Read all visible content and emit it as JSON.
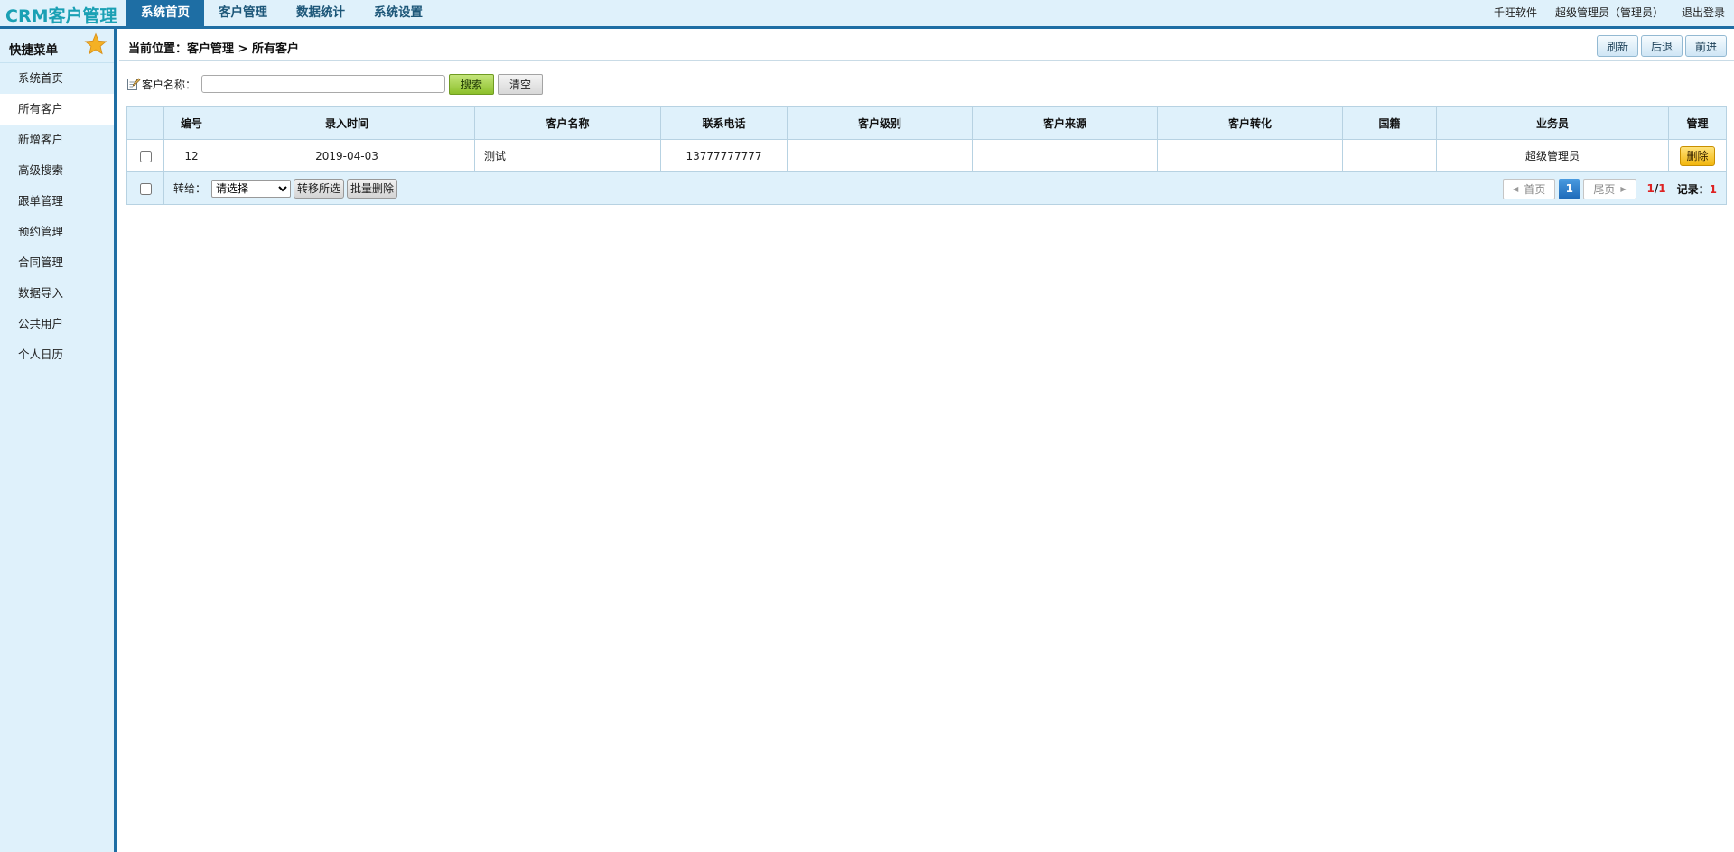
{
  "header": {
    "logo": "CRM客户管理",
    "nav": [
      "系统首页",
      "客户管理",
      "数据统计",
      "系统设置"
    ],
    "right_links": [
      "千旺软件",
      "超级管理员（管理员）",
      "退出登录"
    ]
  },
  "sidebar": {
    "title": "快捷菜单",
    "items": [
      "系统首页",
      "所有客户",
      "新增客户",
      "高级搜索",
      "跟单管理",
      "预约管理",
      "合同管理",
      "数据导入",
      "公共用户",
      "个人日历"
    ],
    "active_index": 1
  },
  "breadcrumb": {
    "text": "当前位置：客户管理 > 所有客户",
    "buttons": [
      "刷新",
      "后退",
      "前进"
    ]
  },
  "search": {
    "label": "客户名称：",
    "value": "",
    "search_btn": "搜索",
    "clear_btn": "清空"
  },
  "table": {
    "headers": [
      "编号",
      "录入时间",
      "客户名称",
      "联系电话",
      "客户级别",
      "客户来源",
      "客户转化",
      "国籍",
      "业务员",
      "管理"
    ],
    "rows": [
      {
        "id": "12",
        "date": "2019-04-03",
        "name": "测试",
        "phone": "13777777777",
        "level": "",
        "source": "",
        "conversion": "",
        "nationality": "",
        "salesman": "超级管理员",
        "action": "删除"
      }
    ]
  },
  "footer": {
    "transfer_label": "转给：",
    "select_value": "请选择",
    "transfer_btn": "转移所选",
    "batch_delete_btn": "批量删除",
    "pager": {
      "first": "首页",
      "current": "1",
      "last": "尾页",
      "page_current": "1",
      "page_total": "1",
      "records_label": "记录：",
      "records": "1"
    }
  },
  "colors": {
    "brand": "#1e6ea4",
    "logo": "#1aa0b4",
    "panel_bg": "#dff1fb"
  }
}
